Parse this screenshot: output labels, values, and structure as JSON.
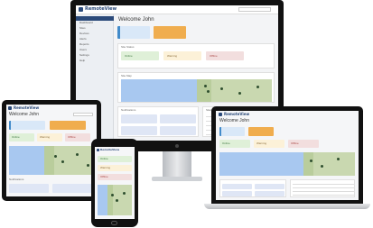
{
  "brand": "RemoteView",
  "welcome": "Welcome John",
  "sidebar": {
    "items": [
      "Dashboard",
      "Sites",
      "Devices",
      "Alerts",
      "Reports",
      "Users",
      "Settings",
      "Help"
    ]
  },
  "status_cards": [
    "Online",
    "Warning",
    "Offline"
  ],
  "sections": {
    "site_status": "Site Status",
    "map": "Site Map",
    "notifications": "Notifications",
    "sites_table": "Sites"
  },
  "colors": {
    "online": "#dff0d8",
    "warning": "#fcf1d8",
    "offline": "#f2dede",
    "primary": "#d9e8f8",
    "orange": "#f0ad4e",
    "sea": "#a8c8f0",
    "land": "#c9d8b0",
    "brand": "#2b4a7a"
  }
}
